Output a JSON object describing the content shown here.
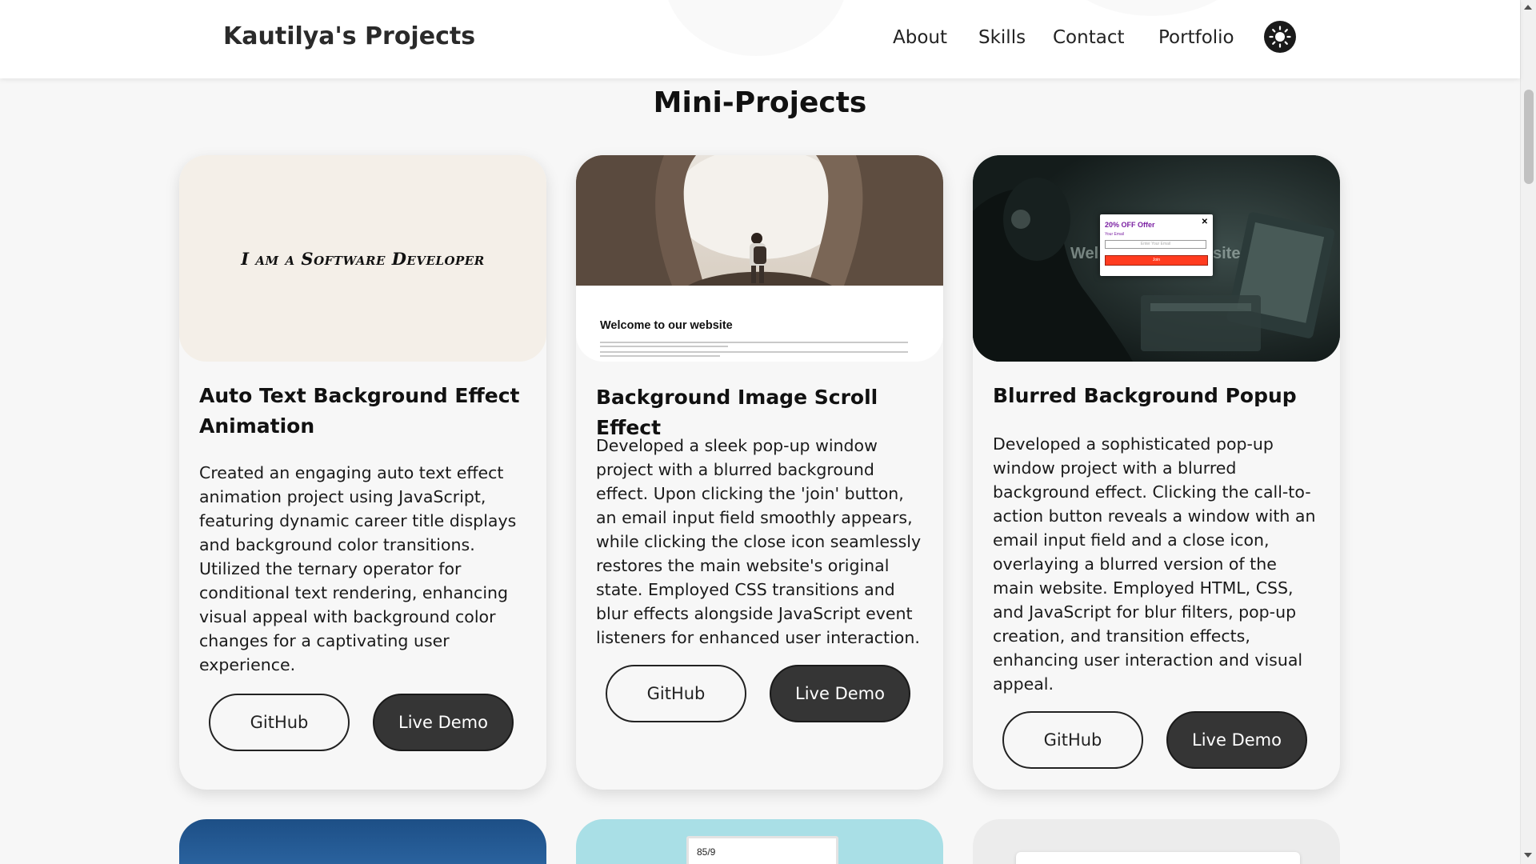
{
  "header": {
    "brand": "Kautilya's Projects",
    "nav": [
      "About",
      "Skills",
      "Contact",
      "Portfolio"
    ],
    "theme_icon": "sun-icon"
  },
  "section": {
    "title": "Mini-Projects"
  },
  "cards": [
    {
      "title": "Auto Text Background Effect Animation",
      "description": "Created an engaging auto text effect animation project using JavaScript, featuring dynamic career title displays and background color transitions. Utilized the ternary operator for conditional text rendering, enhancing visual appeal with background color changes for a captivating user experience.",
      "github_label": "GitHub",
      "demo_label": "Live Demo",
      "thumb_text": "I am a Software Developer"
    },
    {
      "title": "Background Image Scroll Effect",
      "description": "Developed a sleek pop-up window project with a blurred background effect. Upon clicking the 'join' button, an email input field smoothly appears, while clicking the close icon seamlessly restores the main website's original state. Employed CSS transitions and blur effects alongside JavaScript event listeners for enhanced user interaction.",
      "github_label": "GitHub",
      "demo_label": "Live Demo",
      "thumb_text": "Welcome to our website"
    },
    {
      "title": "Blurred Background Popup",
      "description": "Developed a sophisticated pop-up window project with a blurred background effect. Clicking the call-to-action button reveals a window with an email input field and a close icon, overlaying a blurred version of the main website. Employed HTML, CSS, and JavaScript for blur filters, pop-up creation, and transition effects, enhancing user interaction and visual appeal.",
      "github_label": "GitHub",
      "demo_label": "Live Demo",
      "popup_title": "20% OFF Offer",
      "popup_close": "✕",
      "popup_label": "Your Email",
      "popup_placeholder": "Enter Your Email",
      "popup_button": "Join",
      "blur_left": "Wel",
      "blur_right": "site"
    }
  ],
  "bottom_row": {
    "calc_value": "85/9"
  }
}
